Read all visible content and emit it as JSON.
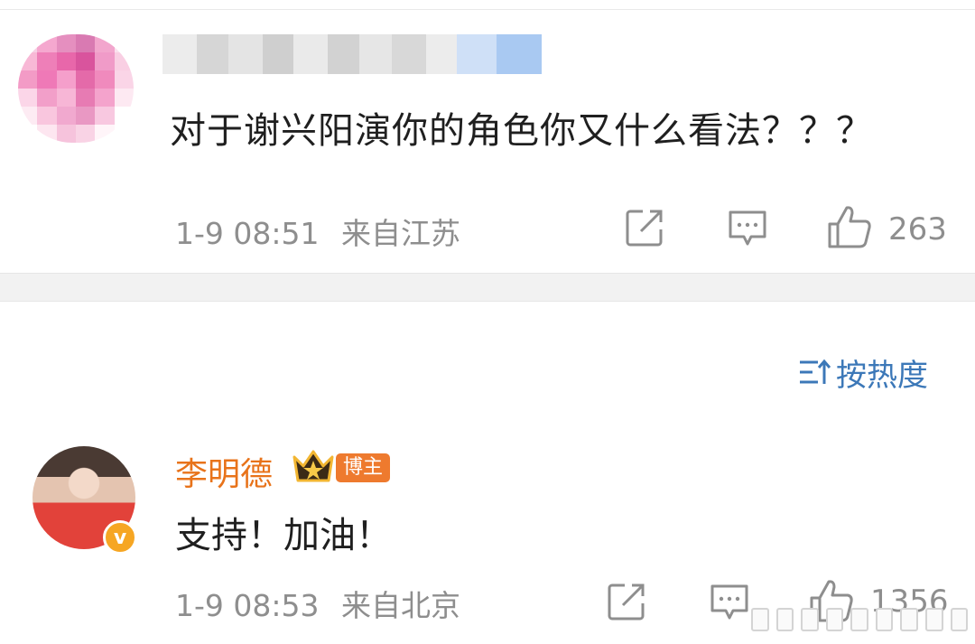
{
  "post": {
    "text": "对于谢兴阳演你的角色你又什么看法？？？",
    "timestamp": "1-9 08:51",
    "location": "来自江苏",
    "like_count": "263"
  },
  "sort": {
    "label": "按热度",
    "icon": "sort-icon"
  },
  "comment": {
    "author": "李明德",
    "badge": "博主",
    "verified_label": "v",
    "text": "支持！加油！",
    "timestamp": "1-9 08:53",
    "location": "来自北京",
    "like_count": "1356"
  },
  "colors": {
    "author_orange": "#e8731a",
    "sort_blue": "#3c78b8",
    "meta_gray": "#8e8e8e"
  }
}
